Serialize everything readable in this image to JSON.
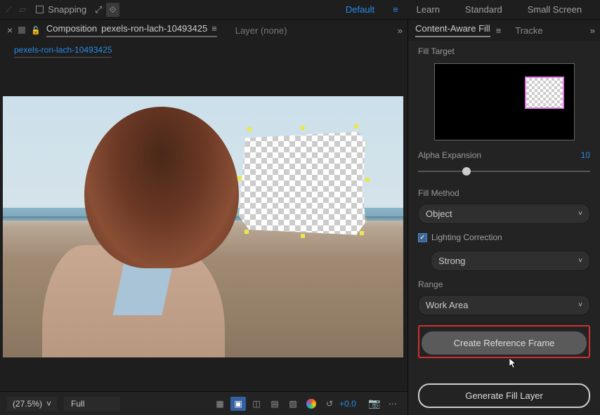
{
  "toolbar": {
    "snapping_label": "Snapping"
  },
  "workspaces": {
    "default": "Default",
    "learn": "Learn",
    "standard": "Standard",
    "small_screen": "Small Screen"
  },
  "comp_header": {
    "composition_label": "Composition",
    "composition_name": "pexels-ron-lach-10493425",
    "layer_label": "Layer",
    "layer_value": "(none)"
  },
  "breadcrumb": {
    "item": "pexels-ron-lach-10493425"
  },
  "footer": {
    "zoom": "(27.5%)",
    "resolution": "Full",
    "exposure": "+0.0"
  },
  "right_panel": {
    "tab1": "Content-Aware Fill",
    "tab2": "Tracke",
    "fill_target_label": "Fill Target",
    "alpha_expansion_label": "Alpha Expansion",
    "alpha_expansion_value": "10",
    "fill_method_label": "Fill Method",
    "fill_method_value": "Object",
    "lighting_correction_label": "Lighting Correction",
    "lighting_strength_value": "Strong",
    "range_label": "Range",
    "range_value": "Work Area",
    "create_ref_button": "Create Reference Frame",
    "generate_fill_button": "Generate Fill Layer"
  }
}
